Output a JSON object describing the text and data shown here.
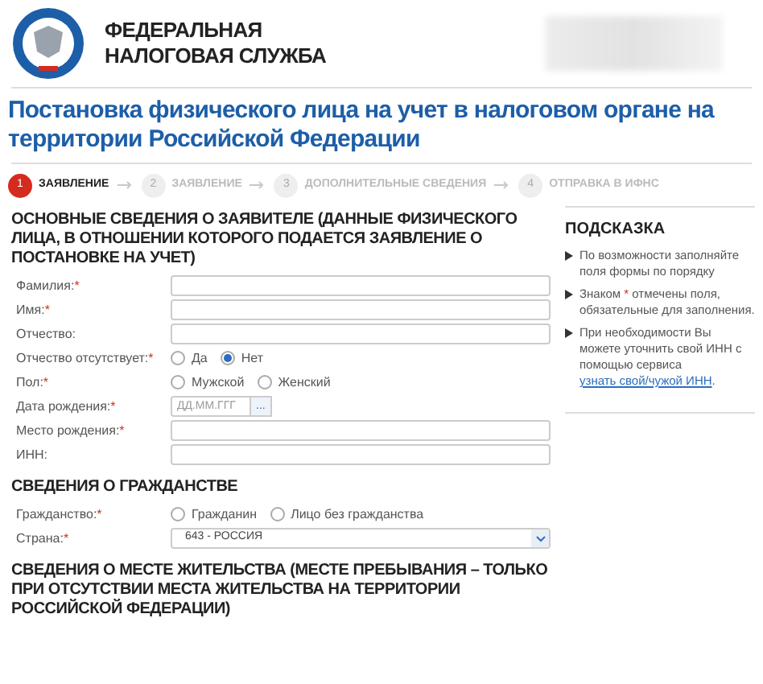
{
  "header": {
    "org_name": [
      "ФЕДЕРАЛЬНАЯ",
      "НАЛОГОВАЯ СЛУЖБА"
    ]
  },
  "page_title": "Постановка физического лица на учет в налоговом органе на территории Российской Федерации",
  "steps": [
    {
      "number": "1",
      "label": "ЗАЯВЛЕНИЕ",
      "selected": true
    },
    {
      "number": "2",
      "label": "ЗАЯВЛЕНИЕ",
      "selected": false
    },
    {
      "number": "3",
      "label": "ДОПОЛНИТЕЛЬНЫЕ СВЕДЕНИЯ",
      "selected": false
    },
    {
      "number": "4",
      "label": "ОТПРАВКА В ИФНС",
      "selected": false
    }
  ],
  "sections": [
    {
      "title": "ОСНОВНЫЕ СВЕДЕНИЯ О ЗАЯВИТЕЛЕ (ДАННЫЕ ФИЗИЧЕСКОГО ЛИЦА, В ОТНОШЕНИИ КОТОРОГО ПОДАЕТСЯ ЗАЯВЛЕНИЕ О ПОСТАНОВКЕ НА УЧЕТ)",
      "fields": [
        {
          "kind": "text",
          "label": "Фамилия:",
          "mark": "*"
        },
        {
          "kind": "text",
          "label": "Имя:",
          "mark": "*"
        },
        {
          "kind": "text",
          "label": "Отчество:"
        },
        {
          "kind": "radio",
          "label": "Отчество отсутствует:",
          "mark": "*",
          "options": [
            {
              "label": "Да",
              "selected": false
            },
            {
              "label": "Нет",
              "selected": true
            }
          ]
        },
        {
          "kind": "radio",
          "label": "Пол:",
          "mark": "*",
          "options": [
            {
              "label": "Мужской",
              "selected": false
            },
            {
              "label": "Женский",
              "selected": false
            }
          ]
        },
        {
          "kind": "date",
          "label": "Дата рождения:",
          "mark": "*",
          "placeholder": "ДД.ММ.ГГГ",
          "button": "..."
        },
        {
          "kind": "text",
          "label": "Место рождения:",
          "mark": "*"
        },
        {
          "kind": "text",
          "label": "ИНН:"
        }
      ]
    },
    {
      "title": "СВЕДЕНИЯ О ГРАЖДАНСТВЕ",
      "fields": [
        {
          "kind": "radio",
          "label": "Гражданство:",
          "mark": "*",
          "options": [
            {
              "label": "Гражданин",
              "selected": false
            },
            {
              "label": "Лицо без гражданства",
              "selected": false
            }
          ]
        },
        {
          "kind": "select",
          "label": "Страна:",
          "mark": "*",
          "value": "643 - РОССИЯ"
        }
      ]
    },
    {
      "title": "СВЕДЕНИЯ О МЕСТЕ ЖИТЕЛЬСТВА (МЕСТЕ ПРЕБЫВАНИЯ – ТОЛЬКО ПРИ ОТСУТСТВИИ МЕСТА ЖИТЕЛЬСТВА НА ТЕРРИТОРИИ РОССИЙСКОЙ ФЕДЕРАЦИИ)"
    }
  ],
  "hint": {
    "title": "ПОДСКАЗКА",
    "items": [
      {
        "parts": [
          {
            "kind": "plain",
            "text": "По возможности заполняйте поля формы по порядку"
          }
        ]
      },
      {
        "parts": [
          {
            "kind": "plain",
            "text": "Знаком"
          },
          {
            "kind": "mark",
            "text": "*"
          },
          {
            "kind": "plain",
            "text": "отмечены поля, обязательные для заполнения."
          }
        ]
      },
      {
        "parts": [
          {
            "kind": "plain",
            "text": "При необходимости Вы можете уточнить свой ИНН с помощью сервиса"
          },
          {
            "kind": "link",
            "text": "узнать свой/чужой ИНН"
          },
          {
            "kind": "tail",
            "text": "."
          }
        ]
      }
    ]
  }
}
